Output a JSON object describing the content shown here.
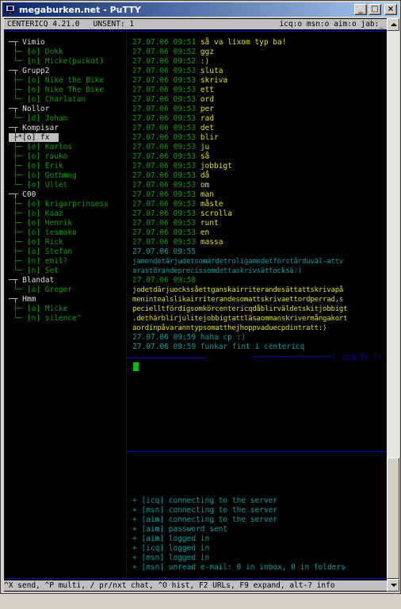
{
  "window": {
    "title": "megaburken.net - PuTTY",
    "min_label": "_",
    "max_label": "□",
    "close_label": "×"
  },
  "header": {
    "left": "CENTERICQ 4.21.0   UNSENT: 1",
    "right": "icq:o msn:o aim:o jab:_"
  },
  "contacts": [
    {
      "text": "─┬ Vimio",
      "kind": "grp"
    },
    {
      "text": " ├─ [o] Dokk",
      "kind": "green"
    },
    {
      "text": " └─ [n] Micke(puckot)",
      "kind": "green"
    },
    {
      "text": "─┬ Grupp2",
      "kind": "grp"
    },
    {
      "text": " ├─ [o] Nike the Bike",
      "kind": "green"
    },
    {
      "text": " ├─ [o] Nike The Bike",
      "kind": "green"
    },
    {
      "text": " └─ [o] Charlatan",
      "kind": "green"
    },
    {
      "text": "─┬ Nollor",
      "kind": "grp"
    },
    {
      "text": " └─ [d] Johan",
      "kind": "green"
    },
    {
      "text": "─┬ Kompisar",
      "kind": "grp"
    },
    {
      "text": " ├*[o] fx  ",
      "kind": "sel"
    },
    {
      "text": " ├─ [o] Karlos",
      "kind": "green"
    },
    {
      "text": " ├─ [o] rauko",
      "kind": "green"
    },
    {
      "text": " ├─ [o] Erik",
      "kind": "green"
    },
    {
      "text": " ├─ [o] Gothmog",
      "kind": "green"
    },
    {
      "text": " └─ [o] Ullet",
      "kind": "green"
    },
    {
      "text": "─┬ C00",
      "kind": "grp"
    },
    {
      "text": " ├─ [o] krigarprinsess",
      "kind": "green"
    },
    {
      "text": " ├─ [o] Kaaz",
      "kind": "green"
    },
    {
      "text": " ├─ [o] Henrik",
      "kind": "green"
    },
    {
      "text": " ├─ [o] tesmako",
      "kind": "green"
    },
    {
      "text": " ├─ [o] Rick",
      "kind": "green"
    },
    {
      "text": " ├─ [a] Stefan",
      "kind": "green"
    },
    {
      "text": " ├─ [n] emil?",
      "kind": "green"
    },
    {
      "text": " └─ [n] Set",
      "kind": "green"
    },
    {
      "text": "─┬ Blandat",
      "kind": "grp"
    },
    {
      "text": " └─ [a] Greger",
      "kind": "green"
    },
    {
      "text": "─┬ Hmm",
      "kind": "grp"
    },
    {
      "text": " ├─ [a] Micke",
      "kind": "green"
    },
    {
      "text": " └─ [n] silence^",
      "kind": "green"
    }
  ],
  "chat": [
    {
      "ts": "27.07.06 09:51",
      "msg": "så va lixom typ ba!",
      "who": "in"
    },
    {
      "ts": "27.07.06 09:52",
      "msg": "ggz",
      "who": "in"
    },
    {
      "ts": "27.07.06 09:52",
      "msg": ":)",
      "who": "in"
    },
    {
      "ts": "27.07.06 09:53",
      "msg": "sluta",
      "who": "in"
    },
    {
      "ts": "27.07.06 09:53",
      "msg": "skriva",
      "who": "in"
    },
    {
      "ts": "27.07.06 09:53",
      "msg": "ett",
      "who": "in"
    },
    {
      "ts": "27.07.06 09:53",
      "msg": "ord",
      "who": "in"
    },
    {
      "ts": "27.07.06 09:53",
      "msg": "per",
      "who": "in"
    },
    {
      "ts": "27.07.06 09:53",
      "msg": "rad",
      "who": "in"
    },
    {
      "ts": "27.07.06 09:53",
      "msg": "det",
      "who": "in"
    },
    {
      "ts": "27.07.06 09:53",
      "msg": "blir",
      "who": "in"
    },
    {
      "ts": "27.07.06 09:53",
      "msg": "ju",
      "who": "in"
    },
    {
      "ts": "27.07.06 09:53",
      "msg": "så",
      "who": "in"
    },
    {
      "ts": "27.07.06 09:53",
      "msg": "jobbigt",
      "who": "in"
    },
    {
      "ts": "27.07.06 09:53",
      "msg": "då",
      "who": "in"
    },
    {
      "ts": "27.07.06 09:53",
      "msg": "om",
      "who": "in"
    },
    {
      "ts": "27.07.06 09:53",
      "msg": "man",
      "who": "in"
    },
    {
      "ts": "27.07.06 09:53",
      "msg": "måste",
      "who": "in"
    },
    {
      "ts": "27.07.06 09:53",
      "msg": "scrolla",
      "who": "in"
    },
    {
      "ts": "27.07.06 09:53",
      "msg": "runt",
      "who": "in"
    },
    {
      "ts": "27.07.06 09:53",
      "msg": "en",
      "who": "in"
    },
    {
      "ts": "27.07.06 09:53",
      "msg": "massa",
      "who": "in"
    }
  ],
  "chat_block1": {
    "ts": "27.07.06 09:55",
    "lines": [
      "jamendetärjudetsomärdetroligamedetförstårduväl-attv",
      "arastörandeprecissomdettaskrivsättocksä:)"
    ]
  },
  "chat_block2": {
    "ts": "27.07.06 09:58",
    "lines": [
      "jodetdärjuockssåettganskairriterandesättattskrivapå",
      "menintealslikairriterandesomattskrivaettordperrad,s",
      "pecielltfördigsomkörcentericqdåblirväldetskitjobbigt",
      ".dethärblirjulitejobbigtattläsaommanskrivermångakort",
      "aordinpåvaranntypsomatthejhoppvaduecpdintratt:)"
    ]
  },
  "chat_tail": [
    {
      "ts": "27.07.06 09:59",
      "msg": "haha cp :)"
    },
    {
      "ts": "27.07.06 09:59",
      "msg": "funkar fint i centericq"
    }
  ],
  "input_label": "[ icq fx ]",
  "log": [
    "+ [icq] connecting to the server",
    "+ [msn] connecting to the server",
    "+ [aim] connecting to the server",
    "+ [aim] password sent",
    "+ [aim] logged in",
    "+ [icq] logged in",
    "+ [msn] logged in",
    "+ [msn] unread e-mail: 0 in inbox, 0 in folders"
  ],
  "footer": "^X send, ^P multi, / pr/nxt chat, ^O hist, F2 URLs, F9 expand, alt-? info"
}
